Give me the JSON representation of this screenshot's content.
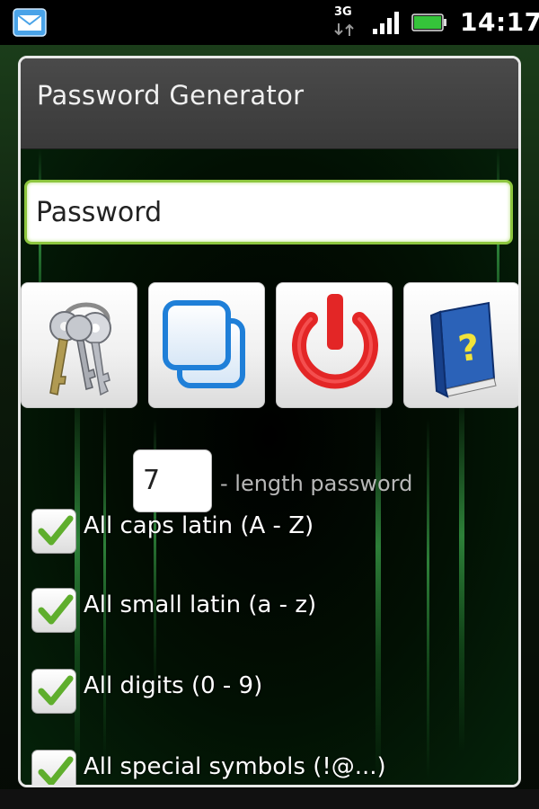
{
  "status_bar": {
    "network_type": "3G",
    "time": "14:17",
    "icons": [
      "mail-notification-icon",
      "network-3g-icon",
      "signal-strength-icon",
      "battery-icon"
    ]
  },
  "dialog": {
    "title": "Password Generator",
    "password_field": {
      "value": "Password",
      "placeholder": ""
    },
    "buttons": [
      {
        "name": "keys",
        "icon": "keys-icon"
      },
      {
        "name": "copy",
        "icon": "copy-icon"
      },
      {
        "name": "exit",
        "icon": "power-icon"
      },
      {
        "name": "help",
        "icon": "help-book-icon"
      }
    ],
    "length": {
      "value": "7",
      "label": "- length password"
    },
    "options": [
      {
        "label": "All caps latin (A - Z)",
        "checked": true
      },
      {
        "label": "All small latin (a - z)",
        "checked": true
      },
      {
        "label": "All digits (0 - 9)",
        "checked": true
      },
      {
        "label": "All special symbols (!@...)",
        "checked": true
      }
    ]
  },
  "colors": {
    "field_border": "#8dc63f",
    "check_green": "#5fae2d",
    "titlebar": "#404040",
    "power_red": "#e32626",
    "copy_blue": "#1f7fd8",
    "book_blue": "#1d4f9c"
  }
}
